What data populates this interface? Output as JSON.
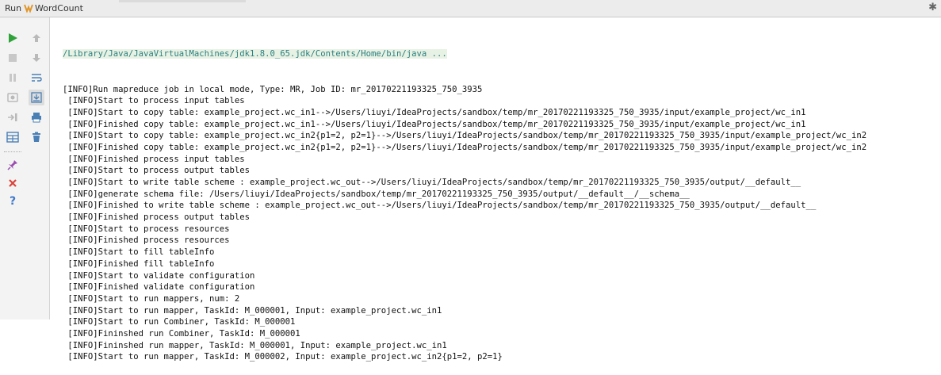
{
  "window": {
    "panel_label": "Run",
    "config_name": "WordCount"
  },
  "toolbar": {
    "buttons": [
      {
        "name": "rerun-icon",
        "color": "#2fa33a"
      },
      {
        "name": "up-icon",
        "color": "#b9b9b9"
      },
      {
        "name": "stop-icon",
        "color": "#c8c8c8"
      },
      {
        "name": "down-icon",
        "color": "#b9b9b9"
      },
      {
        "name": "pause-icon",
        "color": "#c8c8c8"
      },
      {
        "name": "soft-wrap-icon",
        "color": "#4a7fb5"
      },
      {
        "name": "dump-threads-icon",
        "color": "#b9b9b9"
      },
      {
        "name": "scroll-to-end-icon",
        "color": "#4a7fb5"
      },
      {
        "name": "exit-icon",
        "color": "#b9b9b9"
      },
      {
        "name": "print-icon",
        "color": "#4a7fb5"
      },
      {
        "name": "layout-icon",
        "color": "#4a7fb5"
      },
      {
        "name": "trash-icon",
        "color": "#4a7fb5"
      },
      {
        "name": "pin-icon",
        "color": "#9b4fb1"
      },
      {
        "name": "close-icon",
        "color": "#d9433a"
      },
      {
        "name": "help-icon",
        "color": "#3f78c8"
      }
    ]
  },
  "console": {
    "command": "/Library/Java/JavaVirtualMachines/jdk1.8.0_65.jdk/Contents/Home/bin/java ...",
    "lines": [
      "[INFO]Run mapreduce job in local mode, Type: MR, Job ID: mr_20170221193325_750_3935",
      " [INFO]Start to process input tables",
      " [INFO]Start to copy table: example_project.wc_in1-->/Users/liuyi/IdeaProjects/sandbox/temp/mr_20170221193325_750_3935/input/example_project/wc_in1",
      " [INFO]Finished copy table: example_project.wc_in1-->/Users/liuyi/IdeaProjects/sandbox/temp/mr_20170221193325_750_3935/input/example_project/wc_in1",
      " [INFO]Start to copy table: example_project.wc_in2{p1=2, p2=1}-->/Users/liuyi/IdeaProjects/sandbox/temp/mr_20170221193325_750_3935/input/example_project/wc_in2",
      " [INFO]Finished copy table: example_project.wc_in2{p1=2, p2=1}-->/Users/liuyi/IdeaProjects/sandbox/temp/mr_20170221193325_750_3935/input/example_project/wc_in2",
      " [INFO]Finished process input tables",
      " [INFO]Start to process output tables",
      " [INFO]Start to write table scheme : example_project.wc_out-->/Users/liuyi/IdeaProjects/sandbox/temp/mr_20170221193325_750_3935/output/__default__",
      " [INFO]generate schema file: /Users/liuyi/IdeaProjects/sandbox/temp/mr_20170221193325_750_3935/output/__default__/__schema__",
      " [INFO]Finished to write table scheme : example_project.wc_out-->/Users/liuyi/IdeaProjects/sandbox/temp/mr_20170221193325_750_3935/output/__default__",
      " [INFO]Finished process output tables",
      " [INFO]Start to process resources",
      " [INFO]Finished process resources",
      " [INFO]Start to fill tableInfo",
      " [INFO]Finished fill tableInfo",
      " [INFO]Start to validate configuration",
      " [INFO]Finished validate configuration",
      " [INFO]Start to run mappers, num: 2",
      " [INFO]Start to run mapper, TaskId: M_000001, Input: example_project.wc_in1",
      " [INFO]Start to run Combiner, TaskId: M_000001",
      " [INFO]Fininshed run Combiner, TaskId: M_000001",
      " [INFO]Fininshed run mapper, TaskId: M_000001, Input: example_project.wc_in1",
      " [INFO]Start to run mapper, TaskId: M_000002, Input: example_project.wc_in2{p1=2, p2=1}"
    ]
  }
}
